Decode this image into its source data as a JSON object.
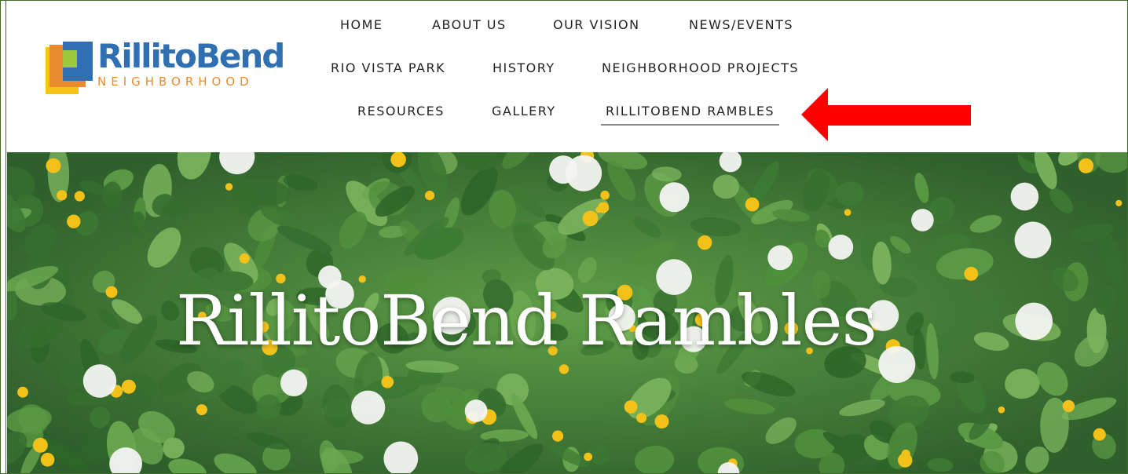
{
  "logo": {
    "word": "RillitoBend",
    "sub": "NEIGHBORHOOD"
  },
  "nav": {
    "row1": [
      {
        "label": "HOME",
        "name": "nav-home"
      },
      {
        "label": "ABOUT US",
        "name": "nav-about-us"
      },
      {
        "label": "OUR VISION",
        "name": "nav-our-vision"
      },
      {
        "label": "NEWS/EVENTS",
        "name": "nav-news-events"
      }
    ],
    "row2": [
      {
        "label": "RIO VISTA PARK",
        "name": "nav-rio-vista-park"
      },
      {
        "label": "HISTORY",
        "name": "nav-history"
      },
      {
        "label": "NEIGHBORHOOD PROJECTS",
        "name": "nav-neighborhood-projects"
      }
    ],
    "row3": [
      {
        "label": "RESOURCES",
        "name": "nav-resources"
      },
      {
        "label": "GALLERY",
        "name": "nav-gallery"
      },
      {
        "label": "RILLITOBEND RAMBLES",
        "name": "nav-rillitobend-rambles",
        "active": true
      }
    ]
  },
  "hero": {
    "title": "RillitoBend Rambles"
  },
  "colors": {
    "brand_blue": "#2f6fb2",
    "brand_orange": "#e98b2e",
    "arrow_red": "#ff0000",
    "frame_green": "#3f6a2a"
  }
}
